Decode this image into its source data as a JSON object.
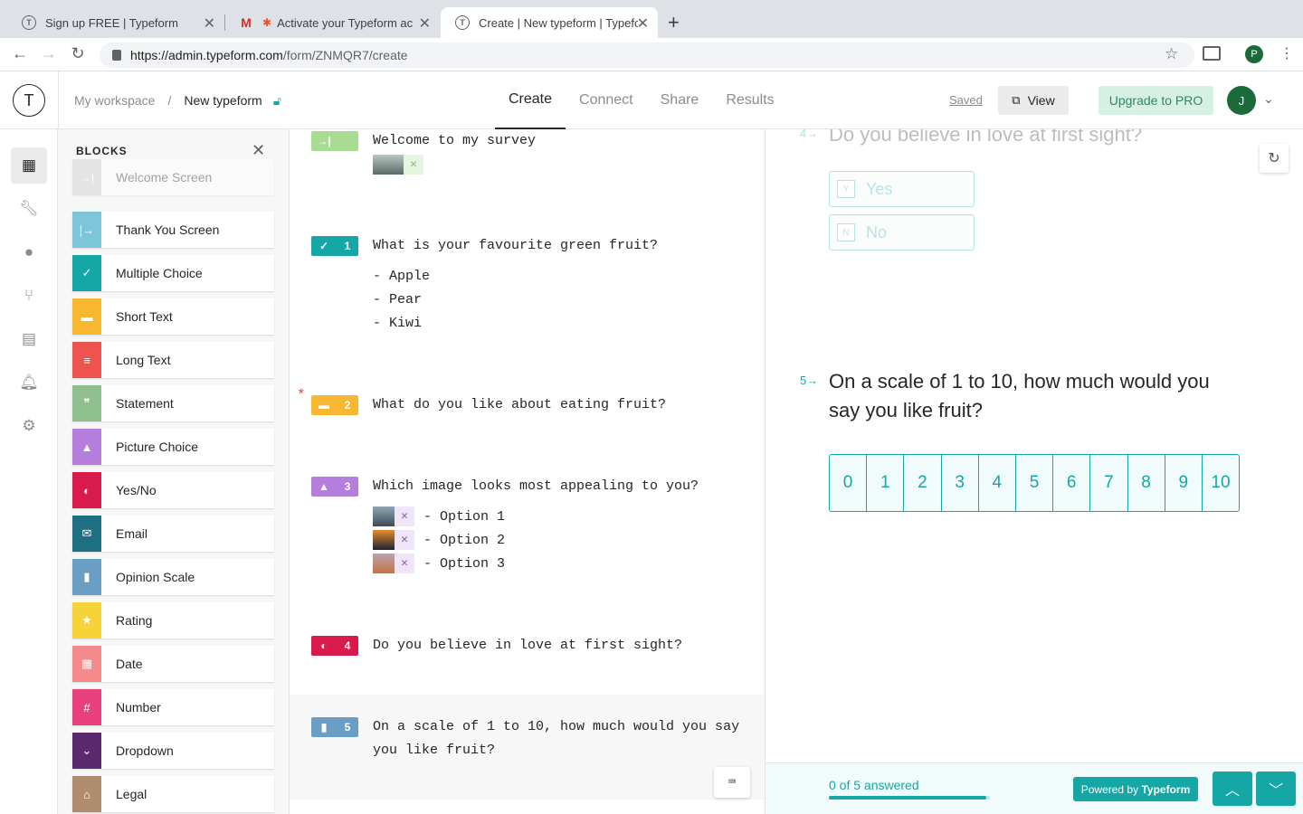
{
  "browser": {
    "tabs": [
      {
        "title": "Sign up FREE | Typeform",
        "fav": "T"
      },
      {
        "title": "Activate your Typeform acc",
        "fav": "M"
      },
      {
        "title": "Create | New typeform | Typefo",
        "fav": "T"
      }
    ],
    "url_host": "https://admin.typeform.com",
    "url_path": "/form/ZNMQR7/create",
    "profile_initial": "P"
  },
  "header": {
    "logo": "T",
    "workspace": "My workspace",
    "separator": "/",
    "form_name": "New typeform",
    "nav": [
      "Create",
      "Connect",
      "Share",
      "Results"
    ],
    "saved": "Saved",
    "view": "View",
    "upgrade": "Upgrade to PRO",
    "avatar": "J"
  },
  "blocks_panel": {
    "title": "BLOCKS",
    "items": [
      {
        "label": "Welcome Screen",
        "color": "#c9c9c9",
        "icon": "→|"
      },
      {
        "label": "Thank You Screen",
        "color": "#7dc6d9",
        "icon": "|→"
      },
      {
        "label": "Multiple Choice",
        "color": "#14a7a5",
        "icon": "✓"
      },
      {
        "label": "Short Text",
        "color": "#f7b731",
        "icon": "▬"
      },
      {
        "label": "Long Text",
        "color": "#ef5350",
        "icon": "≡"
      },
      {
        "label": "Statement",
        "color": "#8fbf8f",
        "icon": "❞"
      },
      {
        "label": "Picture Choice",
        "color": "#b57edc",
        "icon": "▲"
      },
      {
        "label": "Yes/No",
        "color": "#d81b4c",
        "icon": "◐"
      },
      {
        "label": "Email",
        "color": "#1f6f82",
        "icon": "✉"
      },
      {
        "label": "Opinion Scale",
        "color": "#6a9ec4",
        "icon": "▮"
      },
      {
        "label": "Rating",
        "color": "#f7d33a",
        "icon": "★"
      },
      {
        "label": "Date",
        "color": "#f48a8a",
        "icon": "▦"
      },
      {
        "label": "Number",
        "color": "#e8407a",
        "icon": "#"
      },
      {
        "label": "Dropdown",
        "color": "#5b2a6e",
        "icon": "⌄"
      },
      {
        "label": "Legal",
        "color": "#b08c6e",
        "icon": "⌂"
      }
    ]
  },
  "questions": {
    "welcome": {
      "text": "Welcome to my survey",
      "color": "#a8dc92"
    },
    "q1": {
      "num": "1",
      "text": "What is your favourite green fruit?",
      "color": "#14a7a5",
      "options": [
        "- Apple",
        "- Pear",
        "- Kiwi"
      ]
    },
    "q2": {
      "num": "2",
      "text": "What do you like about eating fruit?",
      "color": "#f7b731",
      "required": "*"
    },
    "q3": {
      "num": "3",
      "text": "Which image looks most appealing to you?",
      "color": "#b57edc",
      "options": [
        "- Option 1",
        "- Option 2",
        "- Option 3"
      ]
    },
    "q4": {
      "num": "4",
      "text": "Do you believe in love at first sight?",
      "color": "#d81b4c"
    },
    "q5": {
      "num": "5",
      "text_line1": "On a scale of 1 to 10, how much would you say",
      "text_line2": "you like fruit?",
      "color": "#6a9ec4"
    }
  },
  "preview": {
    "q4_num": "4",
    "q4_text": "Do you believe in love at first sight?",
    "yes_key": "Y",
    "yes": "Yes",
    "no_key": "N",
    "no": "No",
    "q5_num": "5",
    "q5_line1": "On a scale of 1 to 10, how much would you",
    "q5_line2": "say you like fruit?",
    "scale": [
      "0",
      "1",
      "2",
      "3",
      "4",
      "5",
      "6",
      "7",
      "8",
      "9",
      "10"
    ],
    "progress_text": "0 of 5 answered",
    "progress_fraction": 0.98,
    "powered_prefix": "Powered by ",
    "powered_brand": "Typeform",
    "accent": "#14a7a5"
  }
}
